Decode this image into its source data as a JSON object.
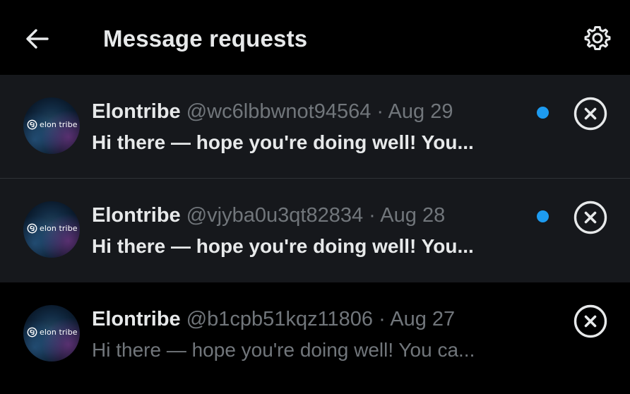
{
  "header": {
    "title": "Message requests",
    "back_icon": "arrow-left-icon",
    "settings_icon": "gear-icon"
  },
  "colors": {
    "background": "#000000",
    "unread_row_bg": "#16181c",
    "primary_text": "#e7e9ea",
    "secondary_text": "#71767b",
    "accent_blue": "#1d9bf0"
  },
  "requests": [
    {
      "name": "Elontribe",
      "handle": "@wc6lbbwnot94564",
      "separator": "·",
      "date": "Aug 29",
      "preview": "Hi there — hope you're doing well! You...",
      "unread": true,
      "avatar_text": "elon tribe"
    },
    {
      "name": "Elontribe",
      "handle": "@vjyba0u3qt82834",
      "separator": "·",
      "date": "Aug 28",
      "preview": "Hi there — hope you're doing well! You...",
      "unread": true,
      "avatar_text": "elon tribe"
    },
    {
      "name": "Elontribe",
      "handle": "@b1cpb51kqz11806",
      "separator": "·",
      "date": "Aug 27",
      "preview": "Hi there — hope you're doing well! You ca...",
      "unread": false,
      "avatar_text": "elon tribe"
    }
  ]
}
